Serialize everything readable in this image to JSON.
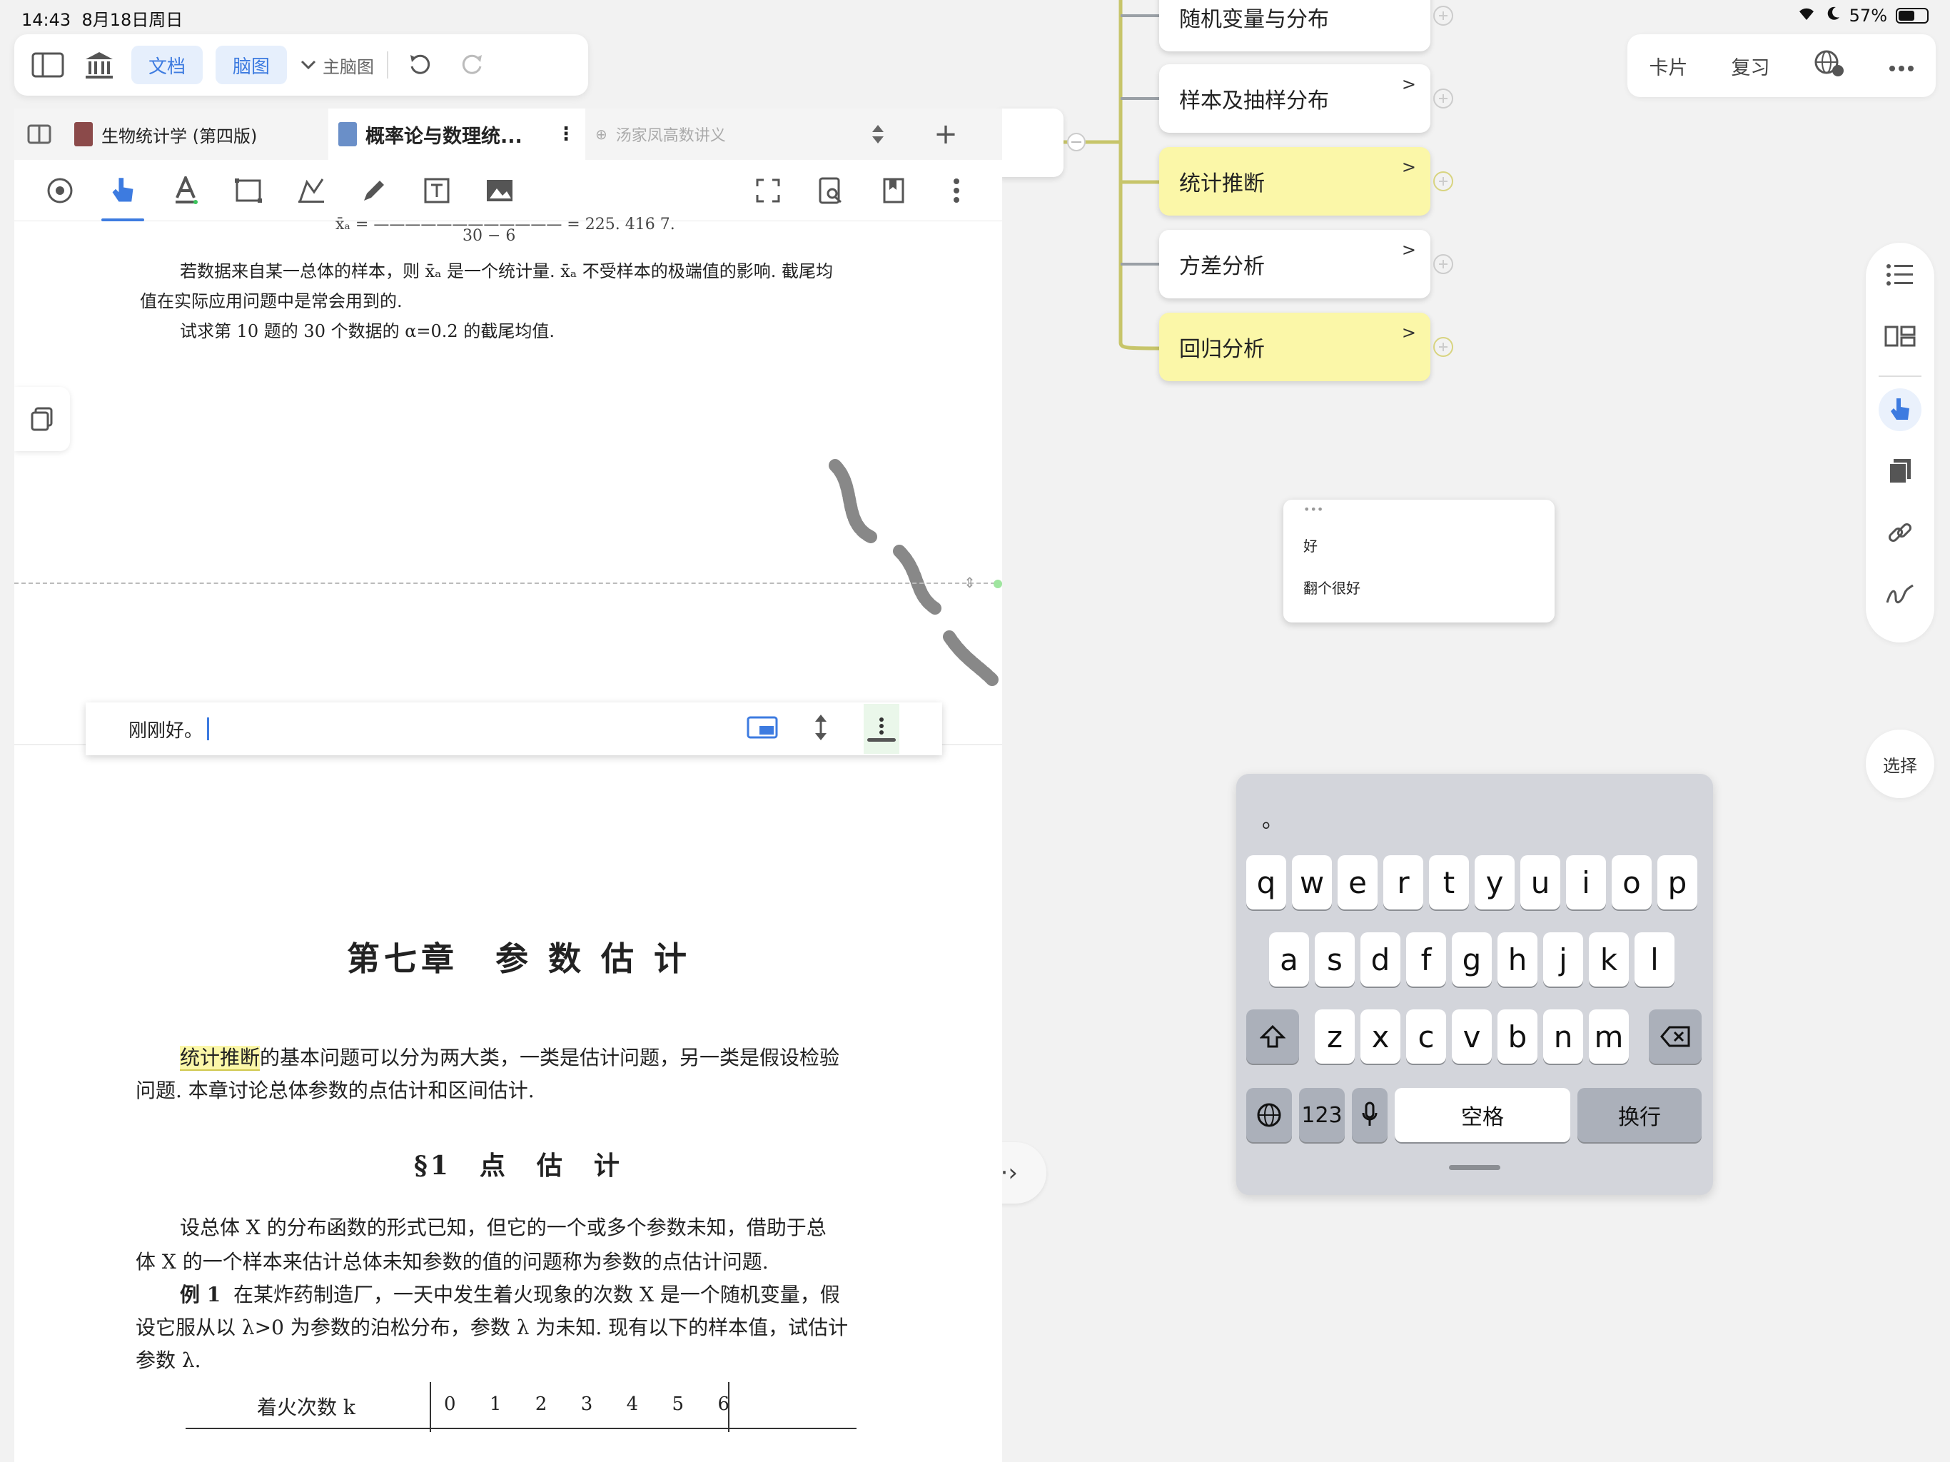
{
  "status": {
    "time": "14:43",
    "date": "8月18日周日",
    "battery": "57%",
    "battery_level": 0.57
  },
  "top_toolbar": {
    "doc_label": "文档",
    "mindmap_label": "脑图",
    "main_mindmap": "主脑图"
  },
  "tabs": [
    {
      "label": "生物统计学 (第四版)"
    },
    {
      "label": "概率论与数理统..."
    },
    {
      "label": "汤家凤高数讲义"
    }
  ],
  "pdf": {
    "formula_text": "x̄ₐ = ———————————— = 225. 416 7.",
    "formula_denominator": "30 − 6",
    "para1_line1": "若数据来自某一总体的样本，则 x̄ₐ 是一个统计量. x̄ₐ 不受样本的极端值的影响. 截尾均",
    "para1_line2": "值在实际应用问题中是常会用到的.",
    "para1_line3": "试求第 10 题的 30 个数据的 α=0.2 的截尾均值.",
    "chapter_title": "第七章　参 数 估 计",
    "intro_highlight": "统计推断",
    "intro_rest": "的基本问题可以分为两大类，一类是估计问题，另一类是假设检验",
    "intro_line2": "问题. 本章讨论总体参数的点估计和区间估计.",
    "section_title": "§1　点　估　计",
    "s1_line1": "设总体 X 的分布函数的形式已知，但它的一个或多个参数未知，借助于总",
    "s1_line2": "体 X 的一个样本来估计总体未知参数的值的问题称为参数的点估计问题.",
    "ex1_label": "例 1",
    "ex1_line1": "在某炸药制造厂，一天中发生着火现象的次数 X 是一个随机变量，假",
    "ex1_line2": "设它服从以 λ>0 为参数的泊松分布，参数 λ 为未知. 现有以下的样本值，试估计",
    "ex1_line3": "参数 λ.",
    "table_header": "着火次数 k",
    "table_values": [
      "0",
      "1",
      "2",
      "3",
      "4",
      "5",
      "6"
    ]
  },
  "note_editor": {
    "text": "刚刚好。"
  },
  "mindmap": {
    "nodes": [
      {
        "label": "随机变量与分布",
        "color": "#ffffff"
      },
      {
        "label": "样本及抽样分布",
        "color": "#ffffff"
      },
      {
        "label": "统计推断",
        "color": "#fbf7a8"
      },
      {
        "label": "方差分析",
        "color": "#ffffff"
      },
      {
        "label": "回归分析",
        "color": "#fbf7a8"
      }
    ],
    "chevron": ">"
  },
  "right_toolbar": {
    "card": "卡片",
    "review": "复习"
  },
  "select_label": "选择",
  "comment": {
    "dots": "•••",
    "line1": "好",
    "line2": "翻个很好"
  },
  "keyboard": {
    "suggestion": "。",
    "row1": [
      "q",
      "w",
      "e",
      "r",
      "t",
      "y",
      "u",
      "i",
      "o",
      "p"
    ],
    "row2": [
      "a",
      "s",
      "d",
      "f",
      "g",
      "h",
      "j",
      "k",
      "l"
    ],
    "row3": [
      "z",
      "x",
      "c",
      "v",
      "b",
      "n",
      "m"
    ],
    "num_label": "123",
    "space_label": "空格",
    "return_label": "换行"
  },
  "colors": {
    "accent": "#3d7be0",
    "highlight": "#fbf7a8",
    "branch": "#c7c56a"
  }
}
